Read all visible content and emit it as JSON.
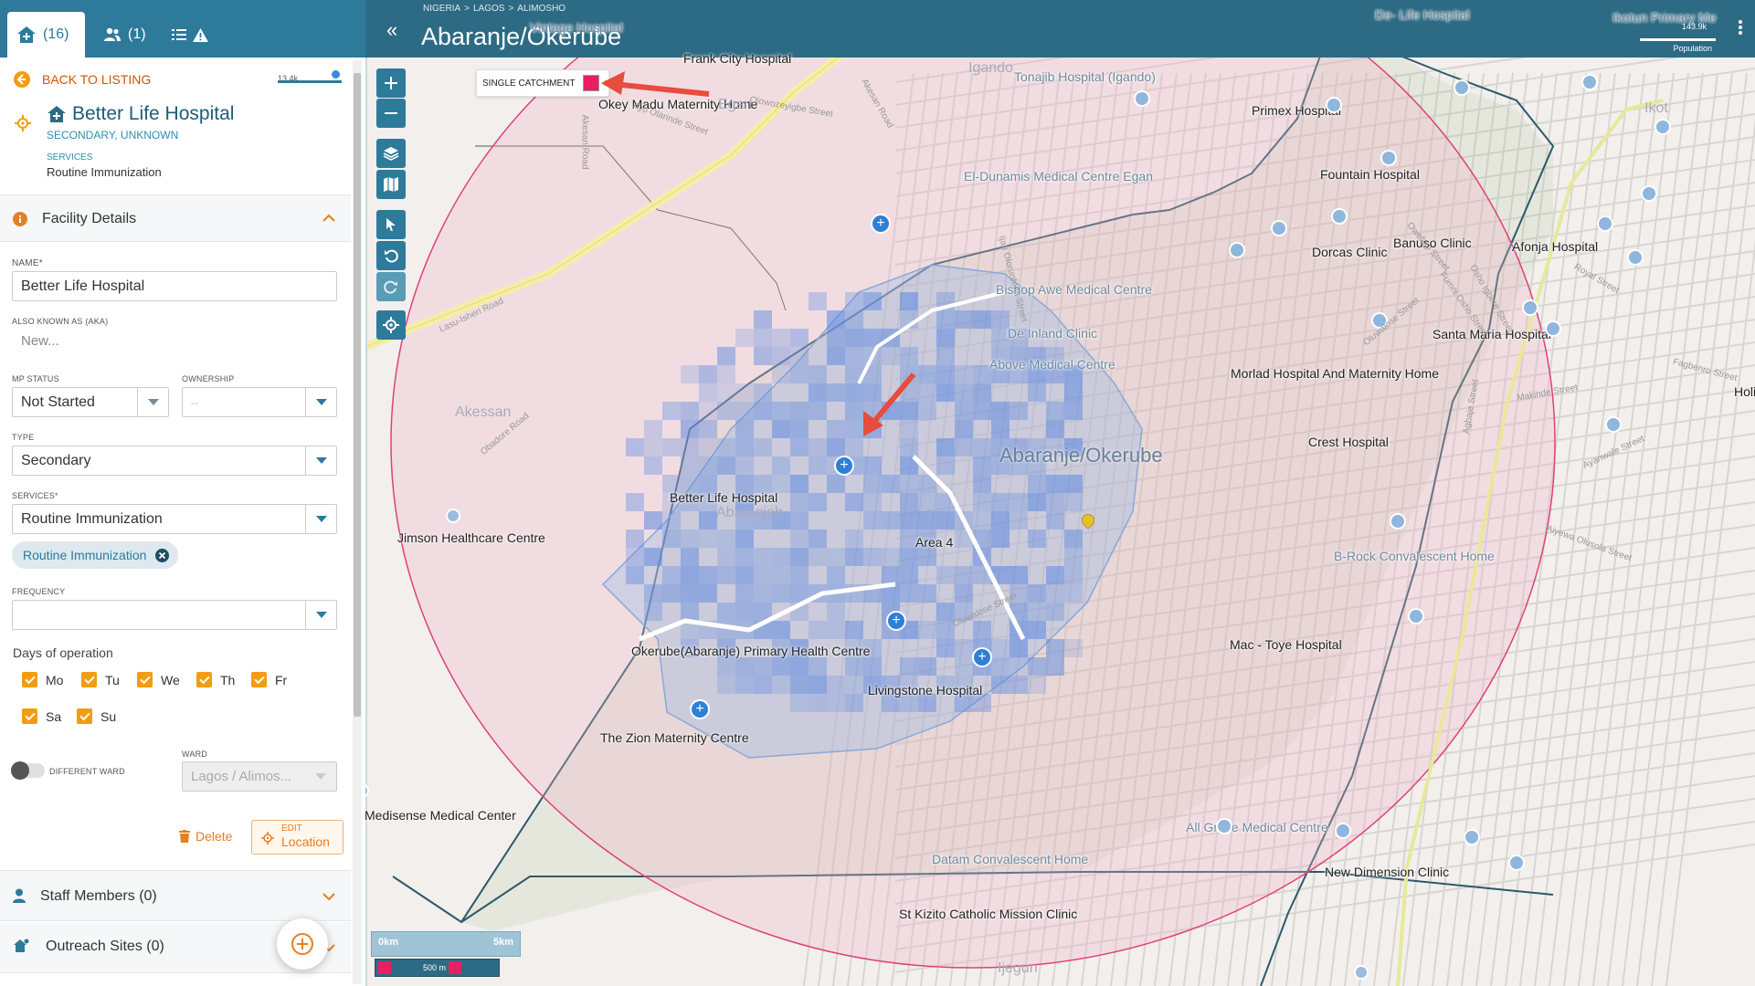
{
  "tabs": [
    {
      "count": "(16)"
    },
    {
      "count": "(1)"
    },
    {
      "count": ""
    }
  ],
  "back_label": "BACK TO LISTING",
  "scale_value": "13.4k",
  "facility": {
    "name": "Better Life Hospital",
    "subtitle": "SECONDARY, UNKNOWN",
    "services_label": "SERVICES",
    "services_value": "Routine Immunization"
  },
  "facility_details_title": "Facility Details",
  "form": {
    "name_label": "NAME*",
    "name_value": "Better Life Hospital",
    "aka_label": "ALSO KNOWN AS (AKA)",
    "aka_placeholder": "New...",
    "mp_status_label": "MP STATUS",
    "mp_status_value": "Not Started",
    "ownership_label": "OWNERSHIP",
    "ownership_value": "--",
    "type_label": "TYPE",
    "type_value": "Secondary",
    "services_label": "SERVICES*",
    "services_value": "Routine Immunization",
    "service_tag": "Routine Immunization",
    "frequency_label": "FREQUENCY",
    "frequency_value": "",
    "days_label": "Days of operation",
    "days": [
      "Mo",
      "Tu",
      "We",
      "Th",
      "Fr",
      "Sa",
      "Su"
    ],
    "different_ward_label": "DIFFERENT WARD",
    "ward_label": "WARD",
    "ward_value": "Lagos / Alimos..."
  },
  "actions": {
    "delete": "Delete",
    "edit_line1": "EDIT",
    "edit_line2": "Location"
  },
  "sections": {
    "staff": "Staff Members (0)",
    "outreach": "Outreach Sites (0)"
  },
  "map": {
    "breadcrumb": [
      "NIGERIA",
      ">",
      "LAGOS",
      ">",
      "ALIMOSHO"
    ],
    "title": "Abaranje/Okerube",
    "population_value": "143.9k",
    "population_label": "Population",
    "legend_label": "SINGLE CATCHMENT",
    "legend_color": "#e91e63",
    "area_label": "Abaranje/Okerube",
    "scale_left": "0km",
    "scale_right": "5km",
    "scale_bottom": "500 m",
    "pois": [
      {
        "name": "Frank City Hospital",
        "gray": false
      },
      {
        "name": "Okey Madu Maternity Home",
        "gray": false
      },
      {
        "name": "Tonajib Hospital (Igando)",
        "gray": true
      },
      {
        "name": "Primex Hospital",
        "gray": false
      },
      {
        "name": "El-Dunamis Medical Centre Egan",
        "gray": true
      },
      {
        "name": "Fountain Hospital",
        "gray": false
      },
      {
        "name": "Dorcas Clinic",
        "gray": false
      },
      {
        "name": "Afonja Hospital",
        "gray": false
      },
      {
        "name": "Banuso Clinic",
        "gray": false
      },
      {
        "name": "Bishop Awe Medical Centre",
        "gray": true
      },
      {
        "name": "Santa Maria Hospital",
        "gray": false
      },
      {
        "name": "De Inland Clinic",
        "gray": true
      },
      {
        "name": "Above Medical Centre",
        "gray": true
      },
      {
        "name": "Morlad Hospital And Maternity Home",
        "gray": false
      },
      {
        "name": "Crest Hospital",
        "gray": false
      },
      {
        "name": "Better Life Hospital",
        "gray": false
      },
      {
        "name": "Jimson Healthcare Centre",
        "gray": false
      },
      {
        "name": "Area 4",
        "gray": false
      },
      {
        "name": "B-Rock Convalescent Home",
        "gray": true
      },
      {
        "name": "Okerube(Abaranje) Primary Health Centre",
        "gray": false
      },
      {
        "name": "Mac - Toye Hospital",
        "gray": false
      },
      {
        "name": "Livingstone Hospital",
        "gray": false
      },
      {
        "name": "The Zion Maternity Centre",
        "gray": false
      },
      {
        "name": "Medisense Medical Center",
        "gray": false
      },
      {
        "name": "All Grace Medical Centre",
        "gray": true
      },
      {
        "name": "Datam Convalescent Home",
        "gray": true
      },
      {
        "name": "New Dimension Clinic",
        "gray": false
      },
      {
        "name": "St Kizito Catholic Mission Clinic",
        "gray": false
      },
      {
        "name": "Vintage Hospital",
        "gray": true
      },
      {
        "name": "De- Life Hospital",
        "gray": true
      },
      {
        "name": "Ikotun Primary Me",
        "gray": true
      },
      {
        "name": "Holi",
        "gray": false
      }
    ],
    "districts": [
      "Igando",
      "Egan",
      "Akessan",
      "Abaranjeh",
      "Ijegun",
      "Ikot"
    ],
    "streets": [
      "Lasu-Isheri Road",
      "Obadore Road",
      "Oluwalose Street",
      "Ijau Olorunfemi Street",
      "Oluwalose Street",
      "Akesan Road",
      "Olowozeyigbe Street",
      "Ayo Olarinde Street",
      "Owefugi Street",
      "Fumni Osho Street",
      "Osho Igbere Street",
      "Agbaje Street",
      "Royal Street",
      "Ayanwale Street",
      "Makinde Street",
      "Akesan Road",
      "Aiyewa Olusola Street",
      "Fagbenro Street"
    ]
  }
}
